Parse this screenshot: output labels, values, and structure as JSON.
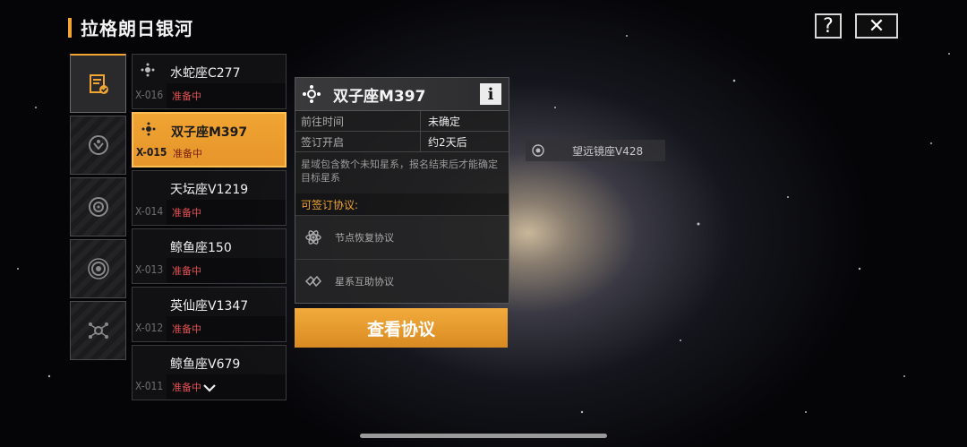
{
  "header": {
    "title": "拉格朗日银河",
    "help_label": "?",
    "close_label": "✕"
  },
  "categories": [
    {
      "icon": "contract-check-icon",
      "active": true
    },
    {
      "icon": "shield-emblem-icon",
      "active": false
    },
    {
      "icon": "target-ring-icon",
      "active": false
    },
    {
      "icon": "orbit-ring-icon",
      "active": false
    },
    {
      "icon": "network-node-icon",
      "active": false
    }
  ],
  "star_list": [
    {
      "code": "X-016",
      "name": "水蛇座C277",
      "status": "准备中"
    },
    {
      "code": "X-015",
      "name": "双子座M397",
      "status": "准备中"
    },
    {
      "code": "X-014",
      "name": "天坛座V1219",
      "status": "准备中"
    },
    {
      "code": "X-013",
      "name": "鲸鱼座150",
      "status": "准备中"
    },
    {
      "code": "X-012",
      "name": "英仙座V1347",
      "status": "准备中"
    },
    {
      "code": "X-011",
      "name": "鲸鱼座V679",
      "status": "准备中"
    }
  ],
  "detail": {
    "title": "双子座M397",
    "info_label": "i",
    "rows": [
      {
        "key": "前往时间",
        "value": "未确定"
      },
      {
        "key": "签订开启",
        "value": "约2天后"
      }
    ],
    "description": "星域包含数个未知星系，报名结束后才能确定目标星系",
    "sign_label": "可签订协议:",
    "protocols": [
      {
        "name": "节点恢复协议",
        "icon": "atom-icon"
      },
      {
        "name": "星系互助协议",
        "icon": "handshake-icon"
      }
    ],
    "view_button": "查看协议"
  },
  "map_tag": {
    "name": "望远镜座V428",
    "icon": "target-ring-icon"
  },
  "colors": {
    "accent": "#f0a432",
    "status": "#e05050"
  }
}
